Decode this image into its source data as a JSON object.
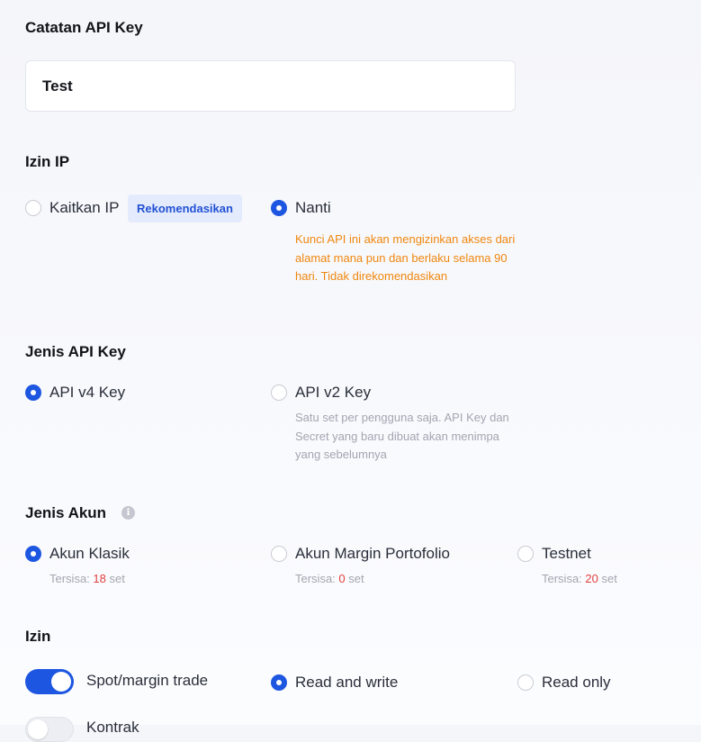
{
  "api_note": {
    "title": "Catatan API Key",
    "value": "Test"
  },
  "ip_permission": {
    "title": "Izin IP",
    "bind_ip_label": "Kaitkan IP",
    "recommend_badge": "Rekomendasikan",
    "later_label": "Nanti",
    "later_selected": true,
    "warning": "Kunci API ini akan mengizinkan akses dari alamat mana pun dan berlaku selama 90 hari. Tidak direkomendasikan"
  },
  "api_key_type": {
    "title": "Jenis API Key",
    "v4_label": "API v4 Key",
    "v4_selected": true,
    "v2_label": "API v2 Key",
    "v2_note": "Satu set per pengguna saja. API Key dan Secret yang baru dibuat akan menimpa yang sebelumnya"
  },
  "account_type": {
    "title": "Jenis Akun",
    "remaining_prefix": "Tersisa: ",
    "remaining_suffix": " set",
    "options": [
      {
        "label": "Akun Klasik",
        "remaining": "18",
        "selected": true
      },
      {
        "label": "Akun Margin Portofolio",
        "remaining": "0",
        "selected": false
      },
      {
        "label": "Testnet",
        "remaining": "20",
        "selected": false
      }
    ]
  },
  "permissions": {
    "title": "Izin",
    "items": [
      {
        "label": "Spot/margin trade",
        "enabled": true,
        "read_write_label": "Read and write",
        "read_only_label": "Read only",
        "mode": "read_write"
      },
      {
        "label": "Kontrak",
        "enabled": false
      }
    ]
  },
  "colors": {
    "accent": "#1d56e0",
    "warning": "#f0870e",
    "remaining_number": "#e04040"
  }
}
